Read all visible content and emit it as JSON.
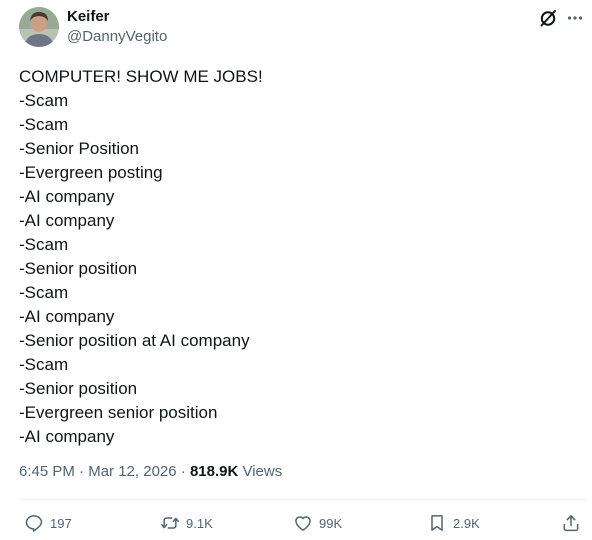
{
  "author": {
    "name": "Keifer",
    "handle": "@DannyVegito"
  },
  "post": {
    "lines": [
      "COMPUTER! SHOW ME JOBS!",
      "-Scam",
      "-Scam",
      "-Senior Position",
      "-Evergreen posting",
      "-AI company",
      "-AI company",
      "-Scam",
      "-Senior position",
      "-Scam",
      "-AI company",
      "-Senior position at AI company",
      "-Scam",
      "-Senior position",
      "-Evergreen senior position",
      "-AI company"
    ]
  },
  "meta": {
    "time": "6:45 PM",
    "separator_1": " · ",
    "date": "Mar 12, 2026",
    "separator_2": " · ",
    "views_count": "818.9K",
    "views_label": " Views"
  },
  "actions": {
    "replies": "197",
    "reposts": "9.1K",
    "likes": "99K",
    "bookmarks": "2.9K"
  },
  "icons": {
    "grok": "grok-icon",
    "more": "more-icon",
    "reply": "reply-icon",
    "repost": "repost-icon",
    "like": "like-icon",
    "bookmark": "bookmark-icon",
    "share": "share-icon"
  },
  "colors": {
    "text_primary": "#0f1419",
    "text_secondary": "#536471",
    "divider": "#eff3f4"
  }
}
